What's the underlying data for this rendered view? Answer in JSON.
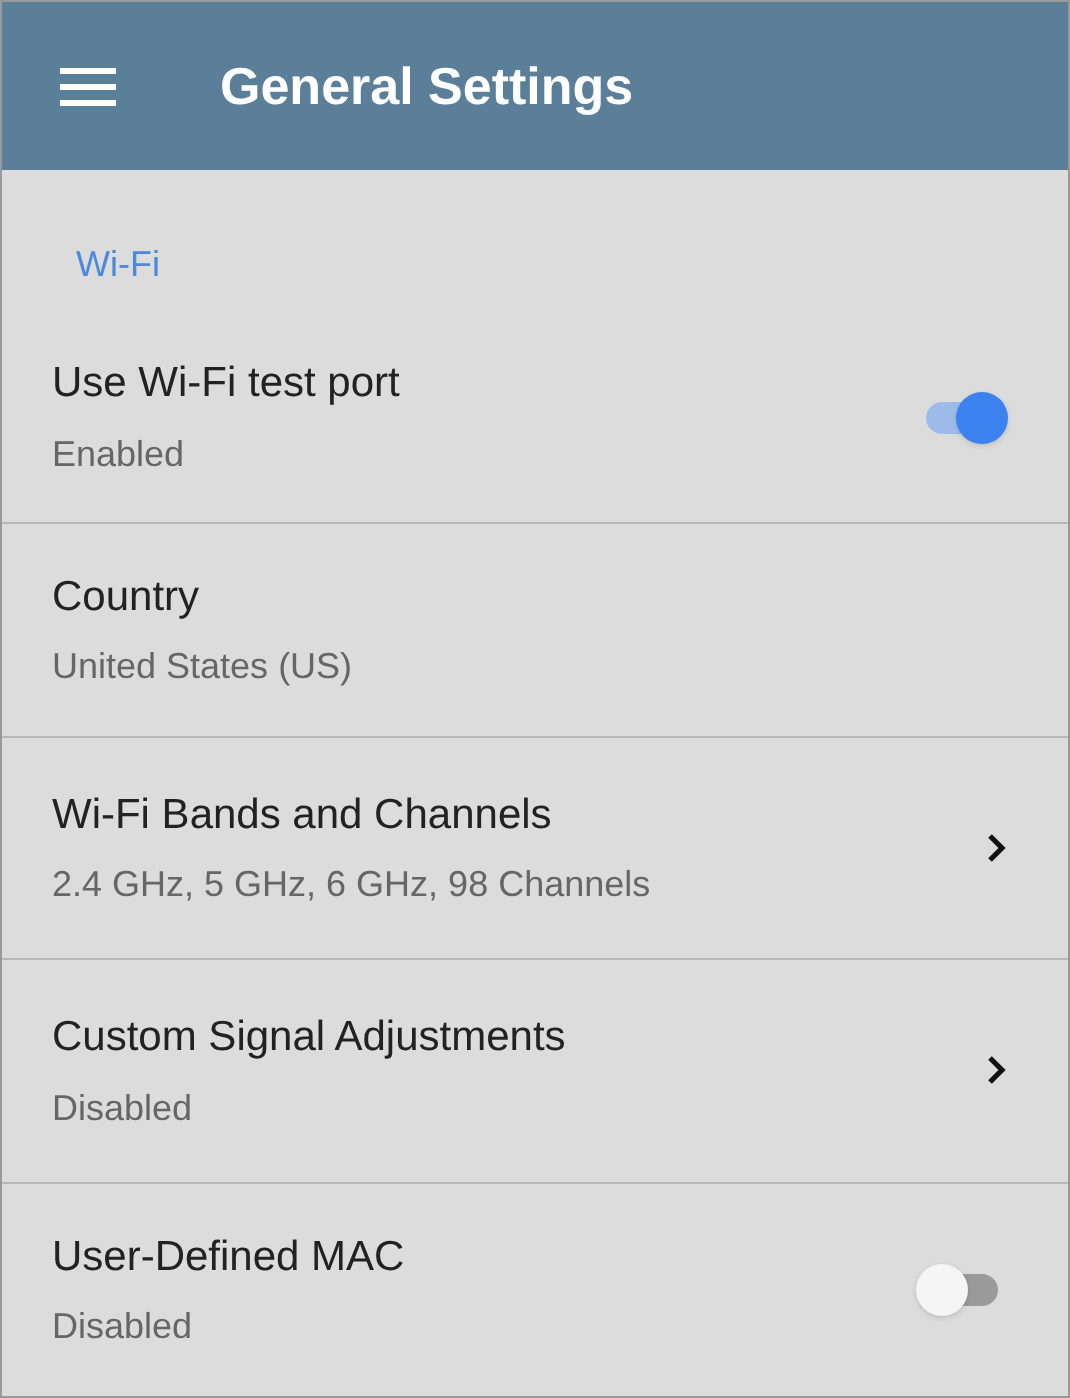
{
  "app_bar": {
    "title": "General Settings"
  },
  "section": {
    "title": "Wi-Fi"
  },
  "items": [
    {
      "kind": "toggle",
      "title": "Use Wi-Fi test port",
      "subtitle": "Enabled",
      "on": true
    },
    {
      "kind": "plain",
      "title": "Country",
      "subtitle": "United States (US)"
    },
    {
      "kind": "chevron",
      "title": "Wi-Fi Bands and Channels",
      "subtitle": "2.4 GHz, 5 GHz, 6 GHz, 98 Channels"
    },
    {
      "kind": "chevron",
      "title": "Custom Signal Adjustments",
      "subtitle": "Disabled"
    },
    {
      "kind": "toggle",
      "title": "User-Defined MAC",
      "subtitle": "Disabled",
      "on": false
    }
  ]
}
